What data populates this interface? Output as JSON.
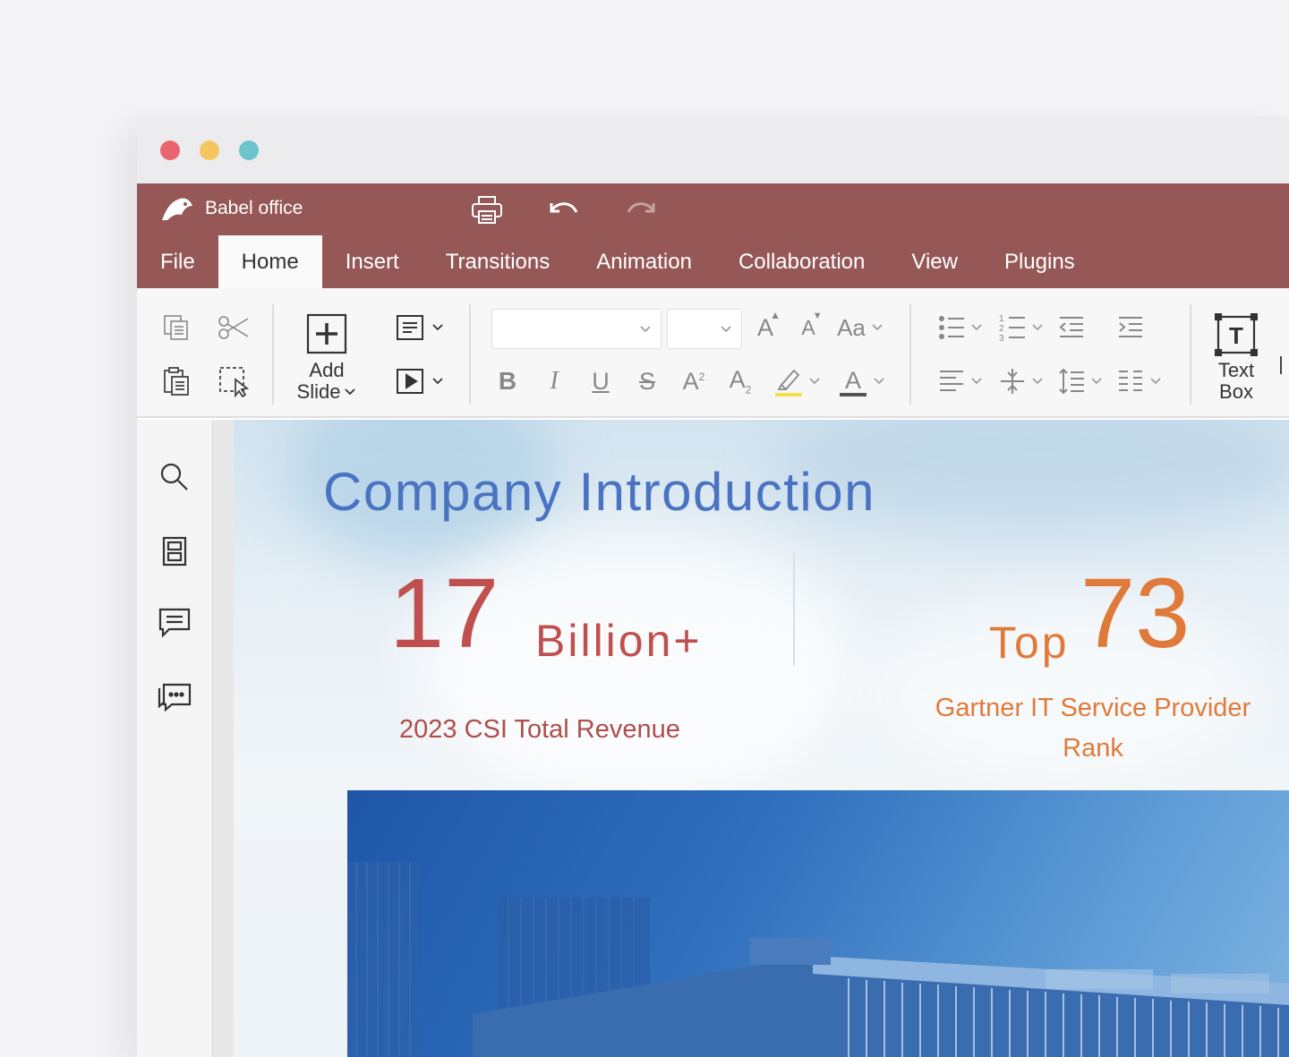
{
  "window": {
    "traffic_lights": [
      {
        "name": "close",
        "color": "#e86570"
      },
      {
        "name": "minimize",
        "color": "#f5c65d"
      },
      {
        "name": "zoom",
        "color": "#6cc4cc"
      }
    ]
  },
  "header": {
    "brand": "Babel office",
    "brand_color": "#955856",
    "quick_access": [
      {
        "icon": "print-icon"
      },
      {
        "icon": "undo-icon"
      },
      {
        "icon": "redo-icon"
      }
    ]
  },
  "tabs": [
    {
      "label": "File",
      "active": false
    },
    {
      "label": "Home",
      "active": true
    },
    {
      "label": "Insert",
      "active": false
    },
    {
      "label": "Transitions",
      "active": false
    },
    {
      "label": "Animation",
      "active": false
    },
    {
      "label": "Collaboration",
      "active": false
    },
    {
      "label": "View",
      "active": false
    },
    {
      "label": "Plugins",
      "active": false
    }
  ],
  "ribbon": {
    "add_slide": {
      "line1": "Add",
      "line2": "Slide"
    },
    "text_box": {
      "line1": "Text",
      "line2": "Box"
    },
    "font_name": {
      "value": ""
    },
    "font_size": {
      "value": ""
    },
    "icons": [
      "copy-icon",
      "cut-icon",
      "paste-icon",
      "select-icon",
      "layout-icon",
      "slideshow-icon",
      "increase-font-icon",
      "decrease-font-icon",
      "change-case-icon",
      "bold-icon",
      "italic-icon",
      "underline-icon",
      "strikethrough-icon",
      "superscript-icon",
      "subscript-icon",
      "highlight-icon",
      "font-color-icon",
      "bullets-icon",
      "numbering-icon",
      "decrease-indent-icon",
      "increase-indent-icon",
      "align-left-icon",
      "vertical-align-icon",
      "line-spacing-icon",
      "columns-icon"
    ],
    "highlight_color": "#f6e04a",
    "font_color_bar": "#555555"
  },
  "sidebar": {
    "icons": [
      "search-icon",
      "slides-panel-icon",
      "comment-icon",
      "chat-icon"
    ]
  },
  "slide": {
    "title": "Company Introduction",
    "stat1": {
      "number": "17",
      "unit": "Billion+",
      "label": "2023 CSI Total Revenue",
      "color": "#c0504f"
    },
    "stat2": {
      "prefix": "Top",
      "number": "73",
      "label_line1": "Gartner IT Service Provider",
      "label_line2": "Rank",
      "color": "#e07a3a"
    },
    "title_color": "#4a73c2"
  }
}
